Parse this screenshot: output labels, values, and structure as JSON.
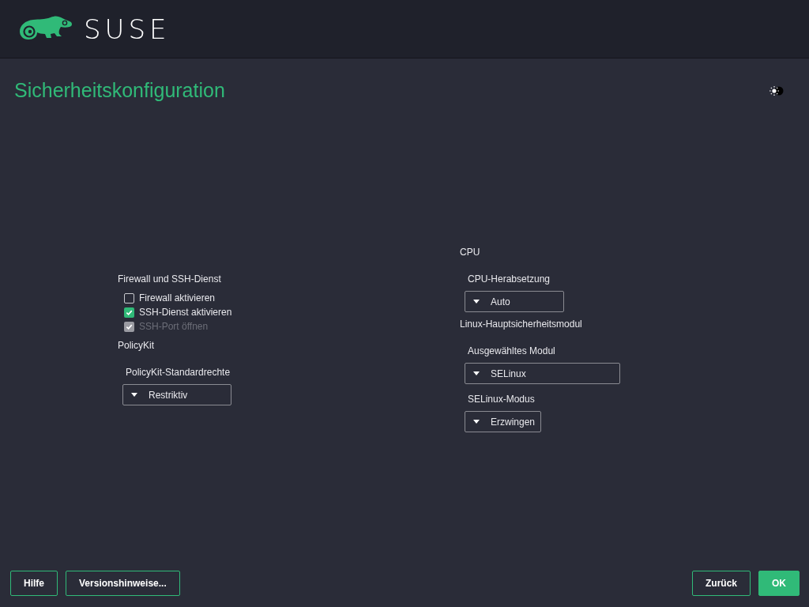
{
  "header": {
    "logo_text": "SUSE"
  },
  "title": "Sicherheitskonfiguration",
  "columns": [
    {
      "sections": [
        {
          "heading": "Firewall und SSH-Dienst",
          "items": [
            {
              "kind": "checkbox",
              "label": "Firewall aktivieren",
              "checked": false,
              "disabled": false
            },
            {
              "kind": "checkbox",
              "label": "SSH-Dienst aktivieren",
              "checked": true,
              "disabled": false
            },
            {
              "kind": "checkbox",
              "label": "SSH-Port öffnen",
              "checked": true,
              "disabled": true
            }
          ]
        },
        {
          "heading": "PolicyKit",
          "items": [
            {
              "kind": "combo",
              "label": "PolicyKit-Standardrechte",
              "value": "Restriktiv"
            }
          ]
        }
      ]
    },
    {
      "sections": [
        {
          "heading": "CPU",
          "items": [
            {
              "kind": "combo",
              "label": "CPU-Herabsetzung",
              "value": "Auto"
            }
          ]
        },
        {
          "heading": "Linux-Hauptsicherheitsmodul",
          "items": [
            {
              "kind": "combo",
              "label": "Ausgewähltes Modul",
              "value": "SELinux"
            },
            {
              "kind": "combo",
              "label": "SELinux-Modus",
              "value": "Erzwingen"
            }
          ]
        }
      ]
    }
  ],
  "footer": {
    "left_buttons": [
      {
        "label": "Hilfe",
        "primary": false
      },
      {
        "label": "Versionshinweise...",
        "primary": false
      }
    ],
    "right_buttons": [
      {
        "label": "Zurück",
        "primary": false
      },
      {
        "label": "OK",
        "primary": true
      }
    ]
  }
}
